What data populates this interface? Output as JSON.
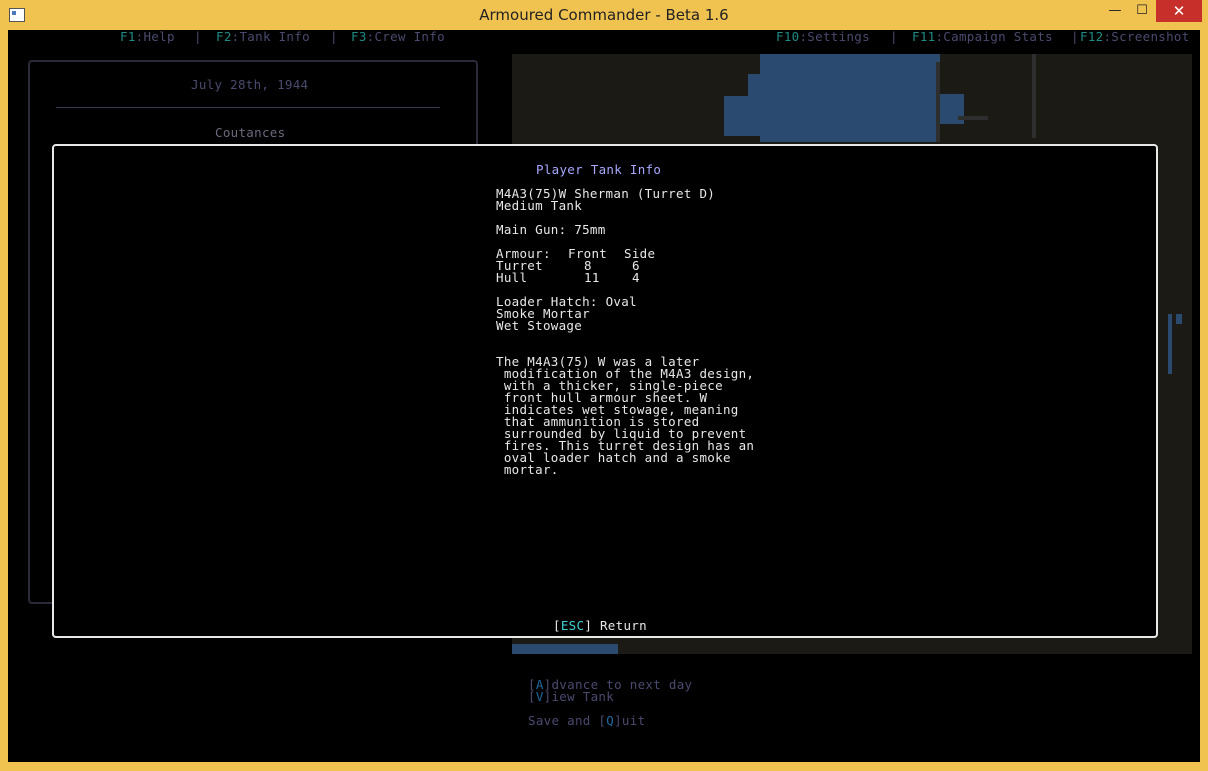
{
  "window": {
    "title": "Armoured Commander - Beta 1.6",
    "min_glyph": "—",
    "max_glyph": "☐",
    "close_glyph": "✕"
  },
  "menu": {
    "help_key": "F1",
    "help_label": ":Help",
    "tank_key": "F2",
    "tank_label": ":Tank Info",
    "crew_key": "F3",
    "crew_label": ":Crew Info",
    "settings_key": "F10",
    "settings_label": ":Settings",
    "stats_key": "F11",
    "stats_label": ":Campaign Stats",
    "screenshot_key": "F12",
    "screenshot_label": ":Screenshot",
    "separator": "|"
  },
  "campaign": {
    "date": "July 28th, 1944",
    "location": "Coutances"
  },
  "dialog": {
    "title": "Player Tank Info",
    "tank_name": "M4A3(75)W Sherman (Turret D)",
    "tank_class": "Medium Tank",
    "main_gun_label": "Main Gun:",
    "main_gun_value": "75mm",
    "armour": {
      "header_label": "Armour:",
      "front_label": "Front",
      "side_label": "Side",
      "rows": [
        {
          "label": "Turret",
          "front": "8",
          "side": "6"
        },
        {
          "label": "Hull",
          "front": "11",
          "side": "4"
        }
      ]
    },
    "loader_hatch_label": "Loader Hatch:",
    "loader_hatch_value": "Oval",
    "features": [
      "Smoke Mortar",
      "Wet Stowage"
    ],
    "description": [
      "The M4A3(75) W was a later",
      " modification of the M4A3 design,",
      " with a thicker, single-piece",
      " front hull armour sheet. W",
      " indicates wet stowage, meaning",
      " that ammunition is stored",
      " surrounded by liquid to prevent",
      " fires. This turret design has an",
      " oval loader hatch and a smoke",
      " mortar."
    ],
    "return_open": "[",
    "return_key": "ESC",
    "return_close": "]",
    "return_label": " Return"
  },
  "actions": {
    "advance_open": "[",
    "advance_key": "A",
    "advance_rest": "]dvance to next day",
    "view_open": "[",
    "view_key": "V",
    "view_rest": "]iew Tank",
    "quit_pre": "Save and [",
    "quit_key": "Q",
    "quit_rest": "]uit"
  },
  "colors": {
    "window_frame": "#f0c24f",
    "close_button": "#c7302a",
    "dialog_title": "#a8a8ff",
    "menu_key": "#1f8a84",
    "water": "#2a4a70"
  }
}
